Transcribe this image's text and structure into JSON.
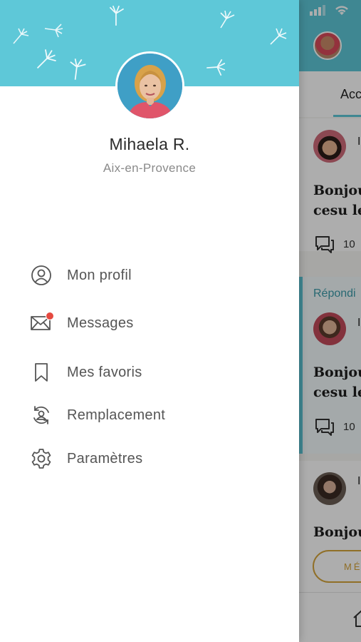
{
  "colors": {
    "accent": "#5ec8d8",
    "notification_dot": "#e5493f",
    "gold": "#d5a43a"
  },
  "drawer": {
    "profile": {
      "name": "Mihaela R.",
      "city": "Aix-en-Provence",
      "avatar_icon": "user-photo"
    },
    "menu": [
      {
        "id": "profile",
        "label": "Mon profil",
        "icon": "user-circle-icon"
      },
      {
        "id": "messages",
        "label": "Messages",
        "icon": "envelope-icon",
        "has_notification": true
      },
      {
        "id": "favorites",
        "label": "Mes favoris",
        "icon": "bookmark-icon"
      },
      {
        "id": "replacement",
        "label": "Remplacement",
        "icon": "user-rotate-icon"
      },
      {
        "id": "settings",
        "label": "Paramètres",
        "icon": "gear-icon"
      }
    ]
  },
  "background": {
    "tab_label": "Acc",
    "cards": [
      {
        "initial": "I",
        "title": "Bonjou\ncesu le",
        "comment_count": "10"
      },
      {
        "section_label": "Répondi",
        "initial": "I",
        "title": "Bonjou\ncesu le",
        "comment_count": "10"
      },
      {
        "initial": "I",
        "title": "Bonjou",
        "button_label": "MÉ"
      }
    ]
  }
}
